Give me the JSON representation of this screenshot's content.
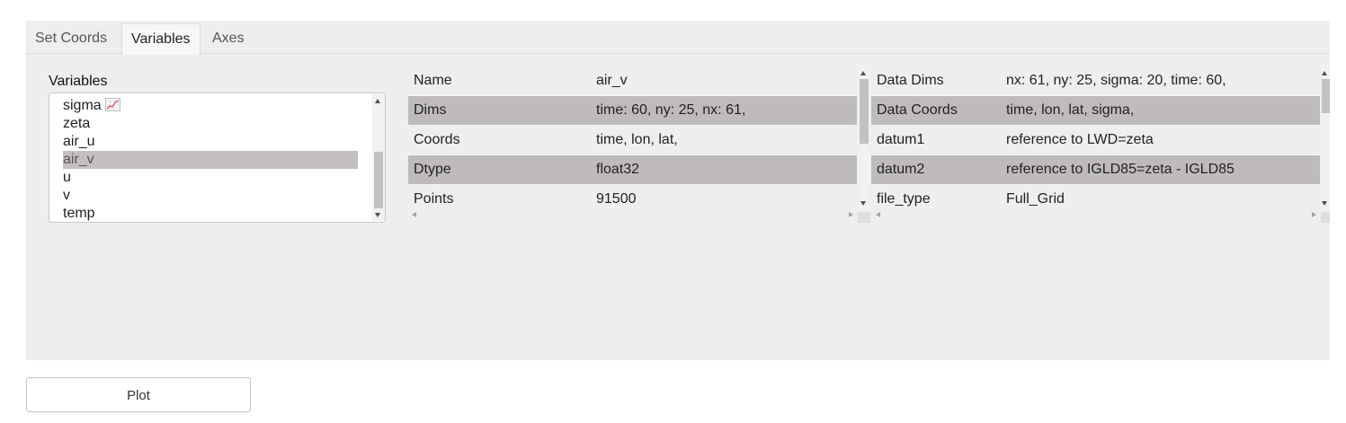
{
  "tabs": [
    {
      "label": "Set Coords",
      "active": false
    },
    {
      "label": "Variables",
      "active": true
    },
    {
      "label": "Axes",
      "active": false
    }
  ],
  "variables": {
    "label": "Variables",
    "items": [
      {
        "name": "sigma",
        "icon": "chart-icon",
        "selected": false
      },
      {
        "name": "zeta",
        "selected": false
      },
      {
        "name": "air_u",
        "selected": false
      },
      {
        "name": "air_v",
        "selected": true
      },
      {
        "name": "u",
        "selected": false
      },
      {
        "name": "v",
        "selected": false
      },
      {
        "name": "temp",
        "selected": false
      }
    ]
  },
  "variable_info": {
    "rows": [
      {
        "key": "Name",
        "value": "air_v"
      },
      {
        "key": "Dims",
        "value": "time: 60, ny: 25, nx: 61,"
      },
      {
        "key": "Coords",
        "value": "time, lon, lat,"
      },
      {
        "key": "Dtype",
        "value": "float32"
      },
      {
        "key": "Points",
        "value": "91500"
      }
    ]
  },
  "dataset_info": {
    "rows": [
      {
        "key": "Data Dims",
        "value": "nx: 61, ny: 25, sigma: 20, time: 60,"
      },
      {
        "key": "Data Coords",
        "value": "time, lon, lat, sigma,"
      },
      {
        "key": "datum1",
        "value": "reference to LWD=zeta"
      },
      {
        "key": "datum2",
        "value": "reference to IGLD85=zeta - IGLD85"
      },
      {
        "key": "file_type",
        "value": "Full_Grid"
      }
    ]
  },
  "plot_button": {
    "label": "Plot"
  },
  "colors": {
    "panel_bg": "#eeeeee",
    "row_shade": "#bfbbbb",
    "selection": "#c4c0c0"
  }
}
